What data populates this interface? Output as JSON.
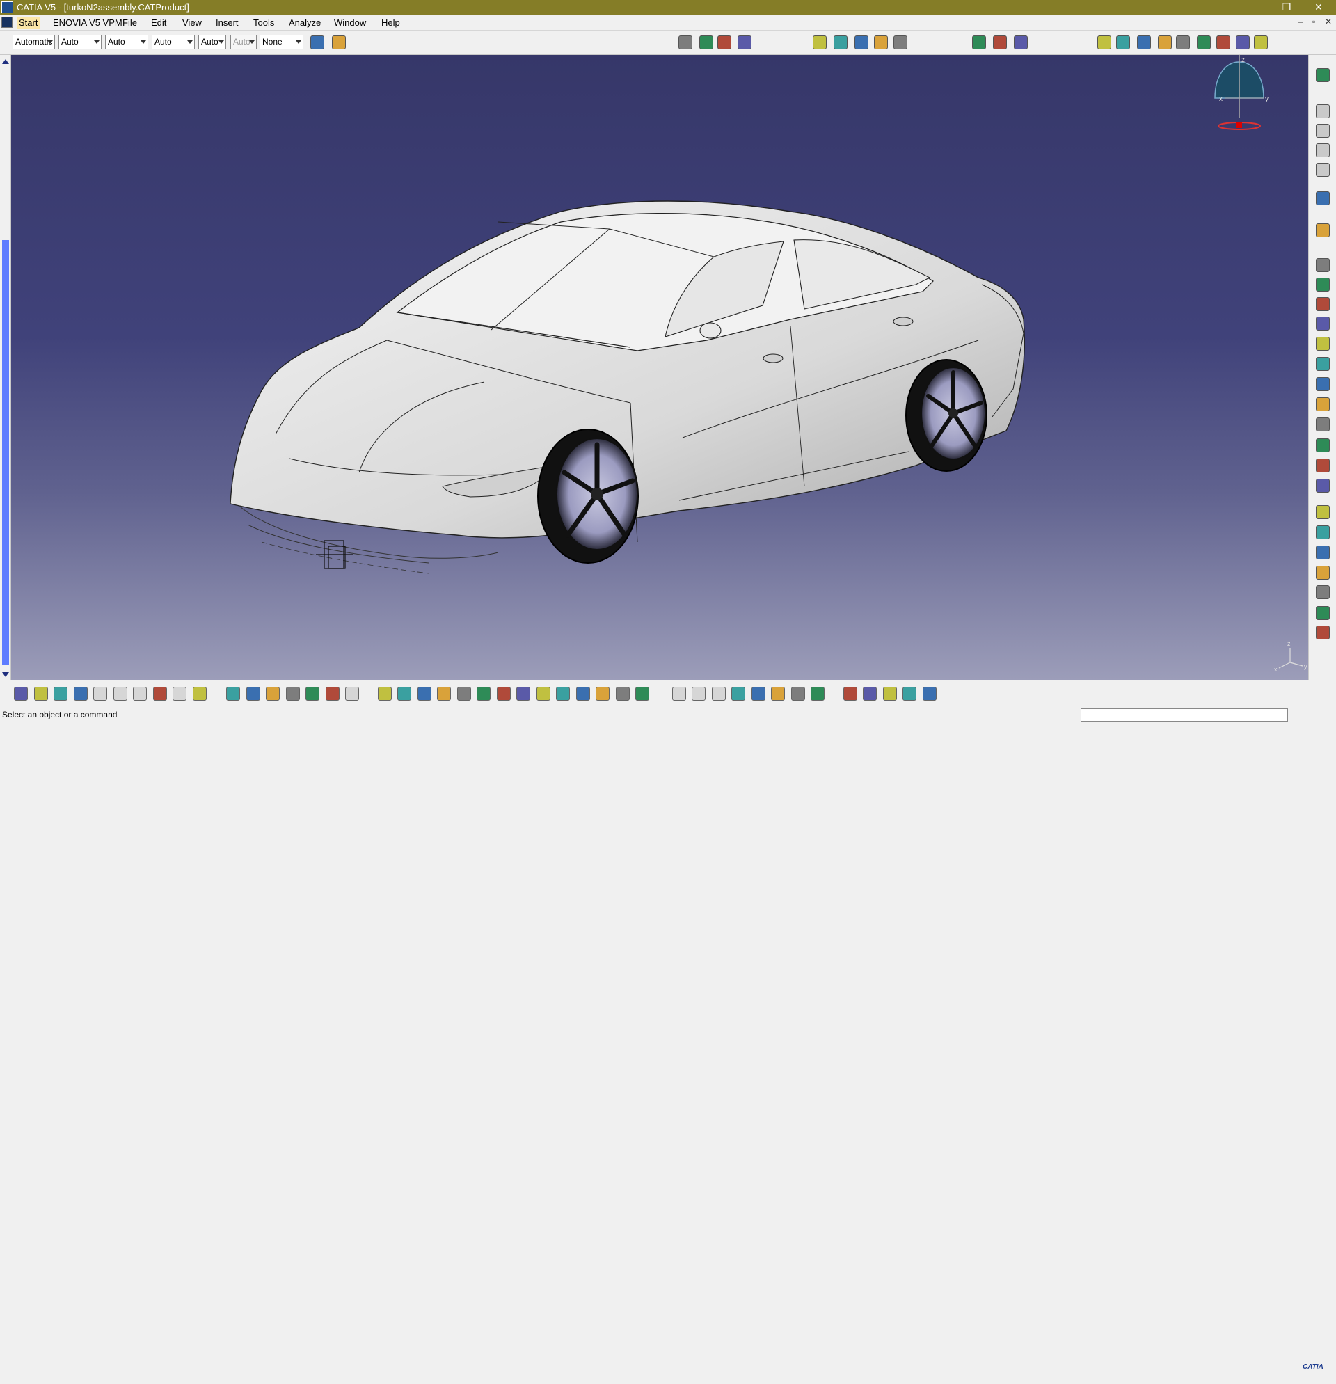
{
  "window": {
    "title": "CATIA V5 - [turkoN2assembly.CATProduct]",
    "controls": [
      "–",
      "❐",
      "✕"
    ]
  },
  "menu": {
    "items": [
      "Start",
      "ENOVIA V5 VPM",
      "File",
      "Edit",
      "View",
      "Insert",
      "Tools",
      "Analyze",
      "Window",
      "Help"
    ],
    "mdi_controls": [
      "–",
      "▫",
      "✕"
    ]
  },
  "graphic_properties": {
    "combos": [
      {
        "value": "Automatic",
        "enabled": true
      },
      {
        "value": "Auto",
        "enabled": true
      },
      {
        "value": "Auto",
        "enabled": true
      },
      {
        "value": "Auto",
        "enabled": true
      },
      {
        "value": "Auto",
        "enabled": true
      },
      {
        "value": "Auto",
        "enabled": false
      },
      {
        "value": "None",
        "enabled": true
      }
    ]
  },
  "toolbar_top": {
    "icons": [
      "painter-brush-icon",
      "paint-palette-icon",
      "catalog-icon",
      "product-management-icon",
      "insert-component-icon",
      "existing-component-icon",
      "measure-between-icon",
      "annotation-text-icon",
      "flag-note-icon",
      "3d-annotation-icon",
      "section-icon",
      "fit-all-icon",
      "multi-view-icon",
      "view-mode-icon",
      "assembly-constraint-icon",
      "coincidence-icon",
      "contact-icon",
      "offset-icon",
      "angle-icon",
      "fix-icon",
      "fix-together-icon",
      "update-icon",
      "reuse-pattern-icon"
    ]
  },
  "right_toolbar": {
    "icons": [
      "snap-icon",
      "component-icon",
      "product-icon",
      "part-icon",
      "existing-icon",
      "select-icon",
      "manipulate-icon",
      "move-icon",
      "explode-icon",
      "stop-manipulate-icon",
      "smart-move-icon",
      "publication-icon",
      "clash-icon",
      "sectioning-icon",
      "distance-icon",
      "flexible-icon",
      "swap-icon",
      "replace-icon",
      "generate-numbering-icon",
      "scene-icon",
      "enhanced-scene-icon",
      "bom-icon",
      "catalog-browser-icon",
      "spec-tree-icon",
      "save-management-icon",
      "send-to-icon"
    ]
  },
  "bottom_toolbar": {
    "icons": [
      "new-icon",
      "open-icon",
      "save-icon",
      "print-icon",
      "cut-icon",
      "copy-icon",
      "paste-icon",
      "undo-icon",
      "redo-icon",
      "whats-this-icon",
      "formula-icon",
      "knowledge-icon",
      "light-icon",
      "table-icon",
      "macros-icon",
      "design-table-icon",
      "law-icon",
      "fly-mode-icon",
      "fit-all-in-icon",
      "pan-icon",
      "rotate-icon",
      "zoom-in-icon",
      "zoom-out-icon",
      "normal-view-icon",
      "quick-view-icon",
      "isometric-view-icon",
      "hide-show-icon",
      "swap-visible-icon",
      "render-style-icon",
      "shading-icon",
      "view-mode-custom-icon",
      "measure-item-icon",
      "measure-inertia-icon",
      "capture-icon",
      "video-icon",
      "move-compass-icon",
      "mass-icon",
      "generate-icon",
      "update-all-icon",
      "sectioning-plane-icon",
      "tree-expand-icon",
      "device-icon",
      "app-icon",
      "grid-icon"
    ]
  },
  "compass": {
    "axis_labels": [
      "z",
      "x",
      "y"
    ]
  },
  "axis_triad": {
    "labels": [
      "z",
      "x",
      "y"
    ]
  },
  "status": {
    "message": "Select an object or a command",
    "logo_text": "CATIA"
  },
  "colors": {
    "titlebar": "#857d27",
    "viewport_top": "#363769",
    "viewport_bottom": "#9c9db9",
    "scroll_thumb": "#5e7cff",
    "model_surface": "#e6e6e6"
  }
}
